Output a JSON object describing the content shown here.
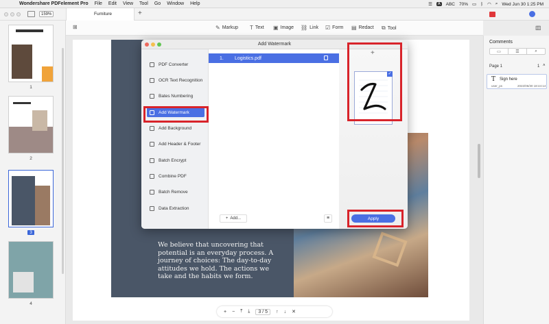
{
  "menubar": {
    "app_name": "Wondershare PDFelement Pro",
    "items": [
      "File",
      "Edit",
      "View",
      "Tool",
      "Go",
      "Window",
      "Help"
    ],
    "status": {
      "input": "ABC",
      "battery": "70%",
      "datetime": "Wed Jun 30  1:25 PM"
    }
  },
  "tabbar": {
    "zoom": "159%",
    "doc_tab": "Furniture"
  },
  "toolbar": {
    "markup": "Markup",
    "text": "Text",
    "image": "Image",
    "link": "Link",
    "form": "Form",
    "redact": "Redact",
    "tool": "Tool"
  },
  "thumbnails": {
    "pages": [
      "1",
      "2",
      "3",
      "4"
    ],
    "selected": "3"
  },
  "document": {
    "quote": "We believe that uncovering that potential is an everyday process. A journey of choices: The day-to-day attitudes we hold. The actions we take and the habits we form."
  },
  "pagenav": {
    "current": "3",
    "total": "5",
    "separator": "/"
  },
  "comments": {
    "title": "Comments",
    "page_label": "Page 1",
    "count": "1",
    "card": {
      "label": "Sign here",
      "user": "user_ps",
      "date": "2022/06/30 18:44:14"
    }
  },
  "modal": {
    "title": "Add Watermark",
    "sidebar": [
      "PDF Converter",
      "OCR Text Recognition",
      "Bates Numbering",
      "Add Watermark",
      "Add Background",
      "Add Header & Footer",
      "Batch Encrypt",
      "Combine PDF",
      "Batch Remove",
      "Data Extraction"
    ],
    "active_item": "Add Watermark",
    "file": {
      "index": "1.",
      "name": "Logistics.pdf"
    },
    "add_label": "Add...",
    "apply_label": "Apply",
    "preview_plus": "+"
  },
  "colors": {
    "accent": "#4a6fe3",
    "highlight": "#d8232a",
    "dark_panel": "#4a5667"
  }
}
